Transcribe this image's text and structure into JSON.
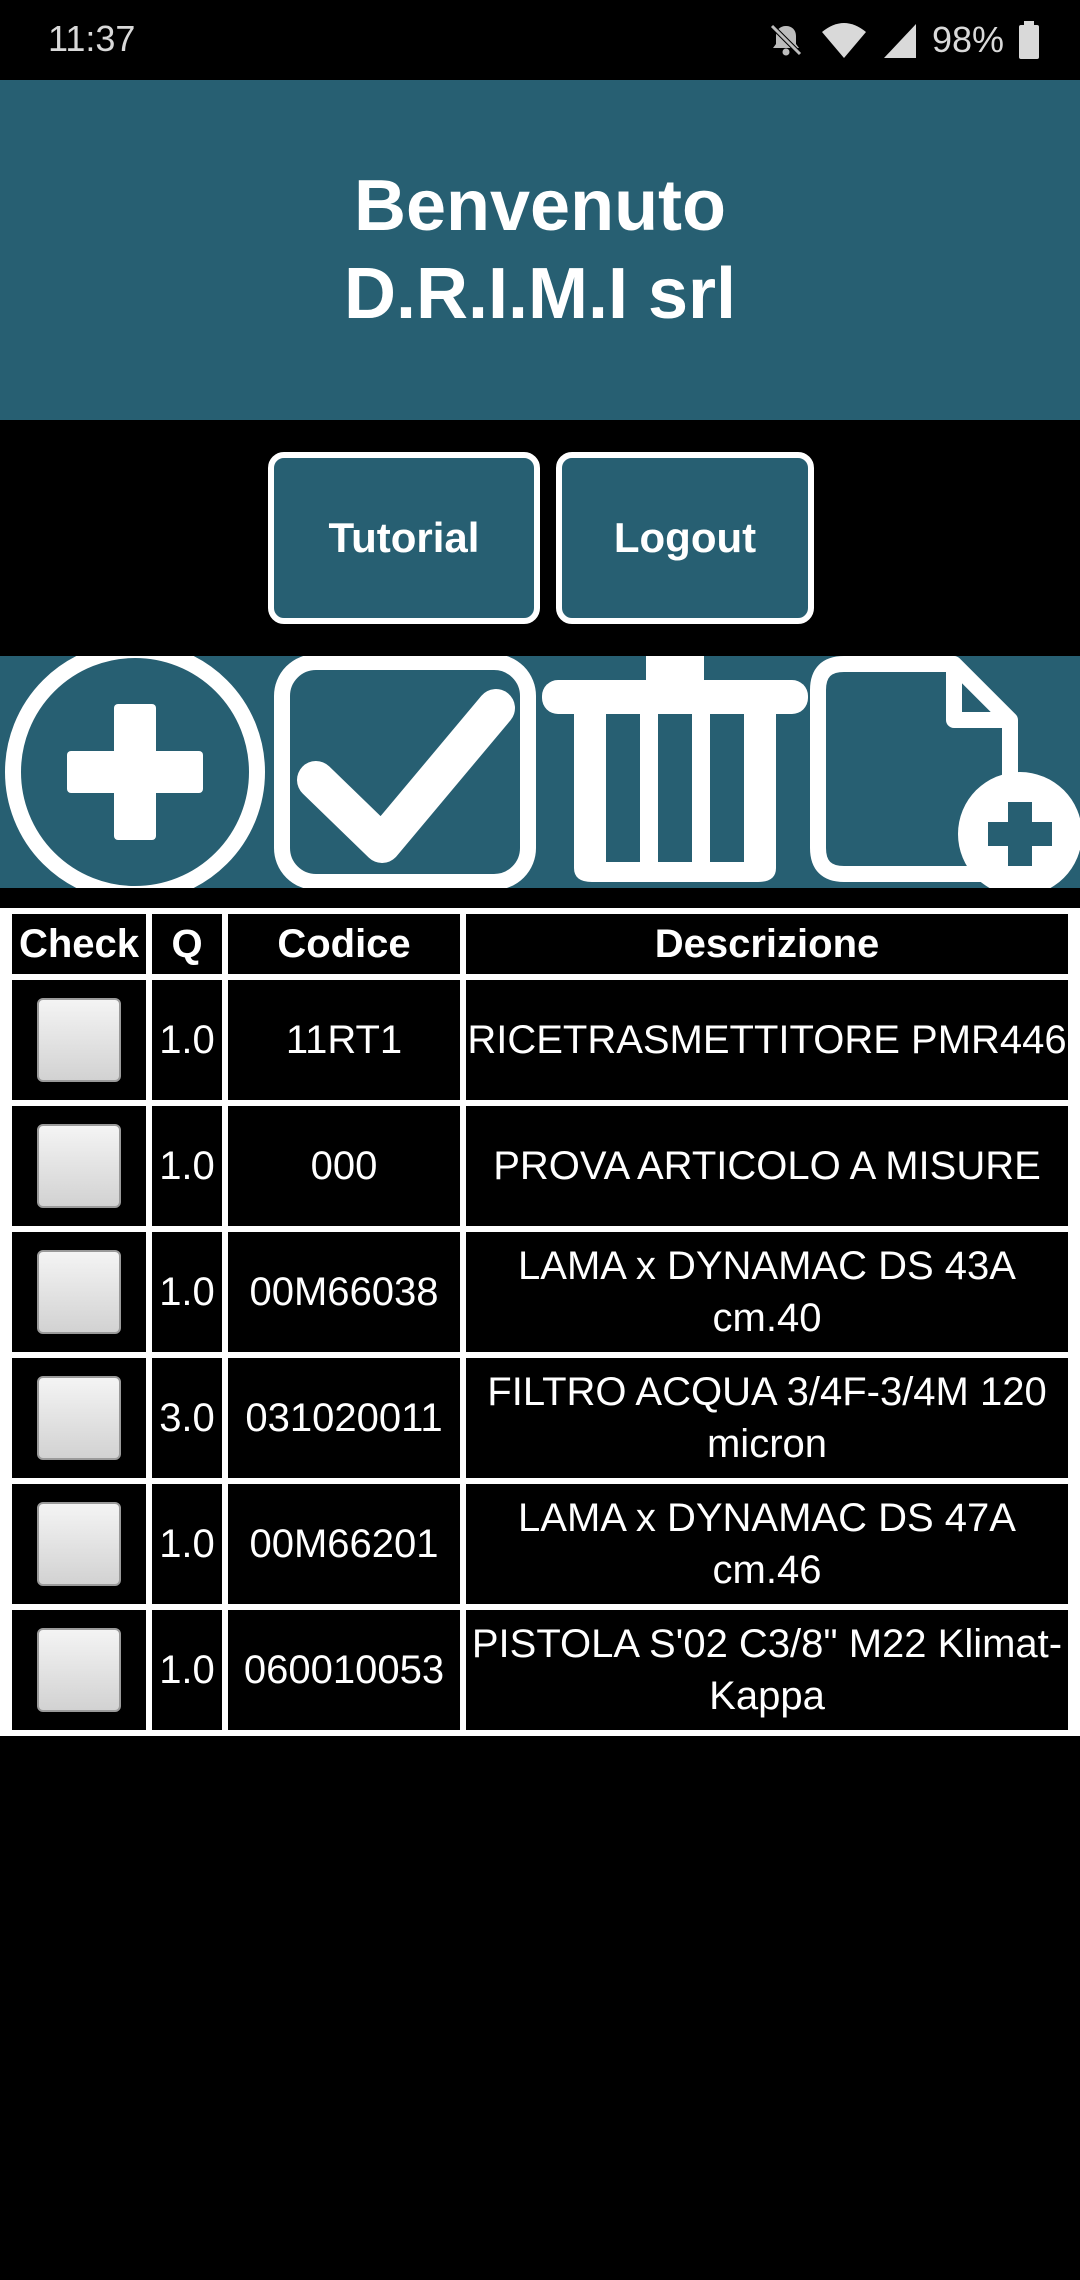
{
  "status_bar": {
    "time": "11:37",
    "battery": "98%",
    "icons": [
      "notifications-off-icon",
      "wifi-icon",
      "signal-icon",
      "battery-icon"
    ]
  },
  "header": {
    "line1": "Benvenuto",
    "line2": "D.R.I.M.I srl"
  },
  "buttons": {
    "tutorial": "Tutorial",
    "logout": "Logout"
  },
  "toolbar": [
    "add-circle-icon",
    "check-box-icon",
    "trash-icon",
    "new-document-icon"
  ],
  "colors": {
    "accent": "#275f72",
    "background": "#000000",
    "text": "#ffffff"
  },
  "table": {
    "headers": [
      "Check",
      "Q",
      "Codice",
      "Descrizione"
    ],
    "rows": [
      {
        "q": "1.0",
        "codice": "11RT1",
        "descrizione": "RICETRASMETTITORE PMR446"
      },
      {
        "q": "1.0",
        "codice": "000",
        "descrizione": "PROVA ARTICOLO A MISURE"
      },
      {
        "q": "1.0",
        "codice": "00M66038",
        "descrizione": "LAMA x DYNAMAC DS 43A cm.40"
      },
      {
        "q": "3.0",
        "codice": "031020011",
        "descrizione": "FILTRO ACQUA 3/4F-3/4M 120 micron"
      },
      {
        "q": "1.0",
        "codice": "00M66201",
        "descrizione": "LAMA x DYNAMAC DS 47A cm.46"
      },
      {
        "q": "1.0",
        "codice": "060010053",
        "descrizione": "PISTOLA S'02 C3/8\" M22 Klimat-Kappa"
      }
    ]
  }
}
